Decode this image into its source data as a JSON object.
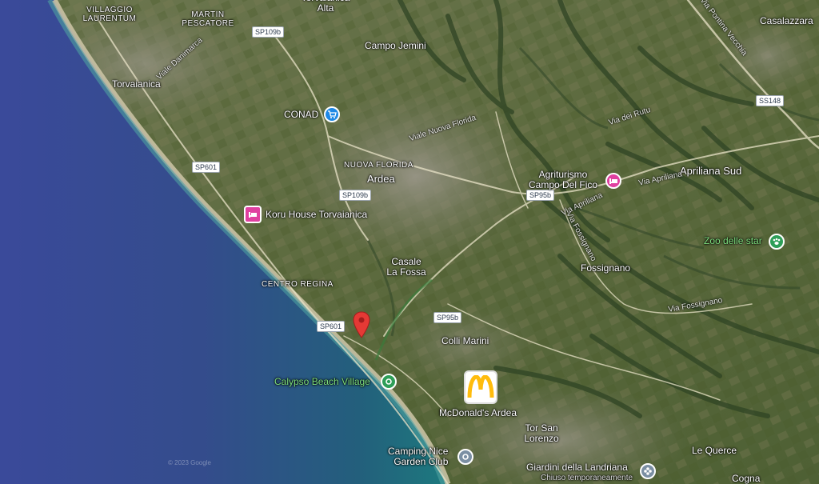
{
  "places": {
    "villaggio_laurentum": "VILLAGGIO\nLAURENTUM",
    "martin_pescatore": "MARTIN\nPESCATORE",
    "torvaianica_alta": "Torvaianica\nAlta",
    "casalazzara": "Casalazzara",
    "campo_jemini": "Campo Jemini",
    "torvaianica": "Torvaianica",
    "nuova_florida": "NUOVA FLORIDA",
    "ardea": "Ardea",
    "apriliana_sud": "Apriliana Sud",
    "casale_la_fossa": "Casale\nLa Fossa",
    "fossignano": "Fossignano",
    "centro_regina": "CENTRO REGINA",
    "colli_marini": "Colli Marini",
    "tor_san_lorenzo": "Tor San\nLorenzo",
    "le_querce": "Le Querce",
    "cogna": "Cogna"
  },
  "streets": {
    "viale_danimarca": "Viale Danimarca",
    "viale_nuova_florida": "Viale Nuova Florida",
    "via_dei_rutuli": "Via dei Rutuli",
    "via_apriliana": "Via Apriliana",
    "via_fossignano": "Via Fossignano",
    "via_pontina_vecchia": "Via Pontina Vecchia",
    "via_del_rutu": "Via dei Rutu",
    "via_apr": "Via Apriliana",
    "via_fossignano2": "Via Fossignano"
  },
  "roads": {
    "sp109b_top": "SP109b",
    "sp109b_mid": "SP109b",
    "sp601_top": "SP601",
    "sp601_bottom": "SP601",
    "sp95b_mid": "SP95b",
    "sp95b_low": "SP95b",
    "ss148": "SS148"
  },
  "pois": {
    "conad": "CONAD",
    "agriturismo": "Agriturismo\nCampo Del Fico",
    "koru_house": "Koru House Torvaianica",
    "zoo": "Zoo delle star",
    "calypso": "Calypso Beach Village",
    "mcdonalds": "McDonald's Ardea",
    "camping": "Camping Nice\nGarden Club",
    "giardini": "Giardini della Landriana",
    "giardini_note": "Chiuso temporaneamente"
  },
  "watermark": "© 2023 Google",
  "colors": {
    "sea_deep": "#34468c",
    "sea_shallow": "#1f6a78",
    "land": "#5a6b3c",
    "urban": "#8a8a7a",
    "pin": "#e53935",
    "shop": "#1e88e5",
    "hotel": "#e040a0",
    "park": "#2e9e58",
    "camping": "#7b8fa3",
    "mcd_bg": "#ffffff",
    "mcd_arch": "#ffbc0d"
  }
}
